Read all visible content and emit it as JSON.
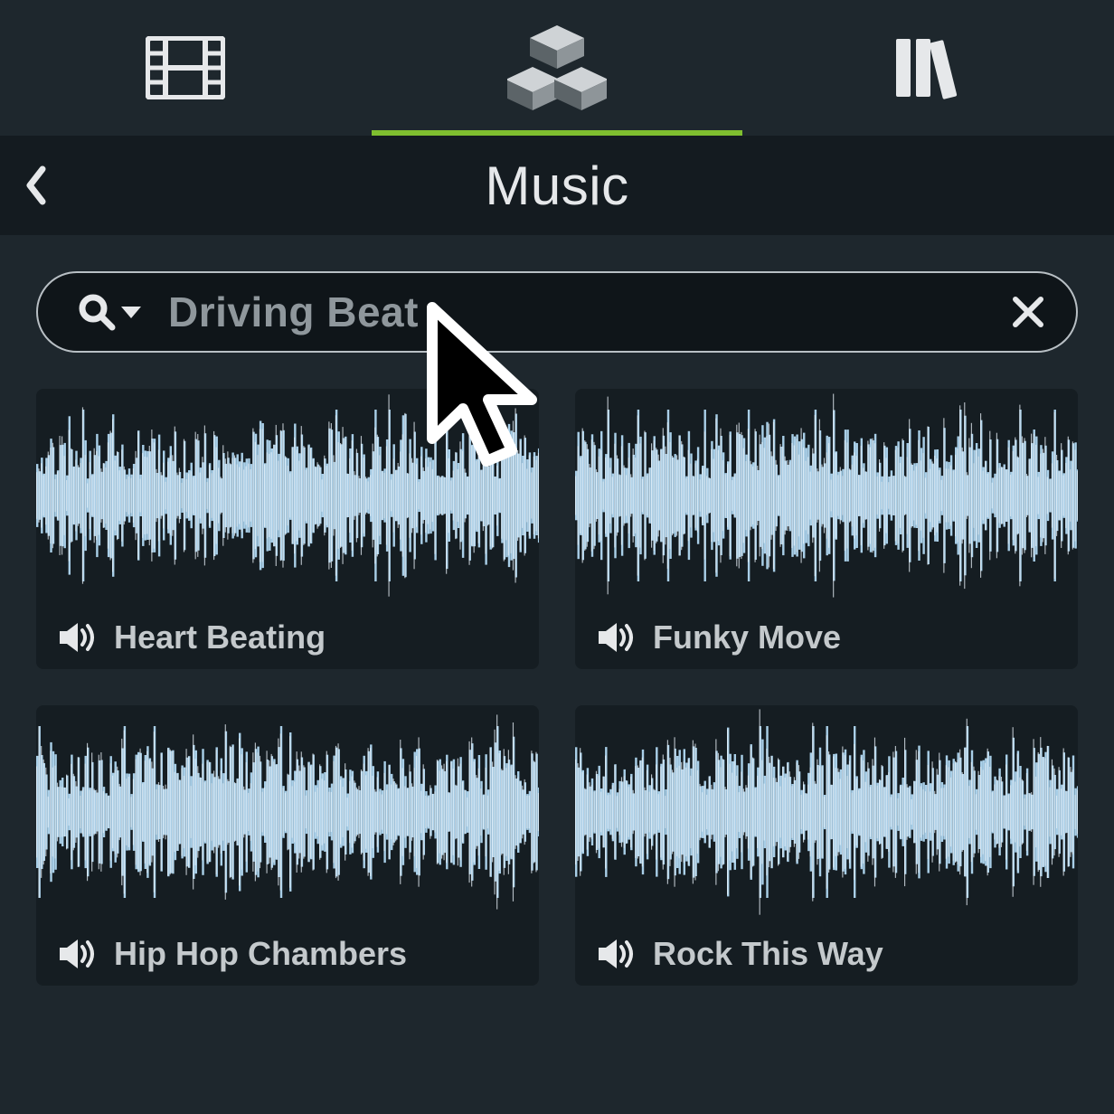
{
  "tabs": {
    "media_icon": "film-icon",
    "assets_icon": "cubes-icon",
    "library_icon": "books-icon",
    "active_index": 1
  },
  "header": {
    "title": "Music",
    "back_label": "back"
  },
  "search": {
    "value": "Driving Beat",
    "placeholder": "Search",
    "clear_label": "clear"
  },
  "tracks": [
    {
      "title": "Heart Beating"
    },
    {
      "title": "Funky Move"
    },
    {
      "title": "Hip Hop Chambers"
    },
    {
      "title": "Rock This Way"
    }
  ],
  "colors": {
    "accent": "#7fbf2f",
    "waveform": "#a9cfe8",
    "bg_dark": "#141b20",
    "bg_panel": "#1e272d",
    "card": "#151d22"
  }
}
